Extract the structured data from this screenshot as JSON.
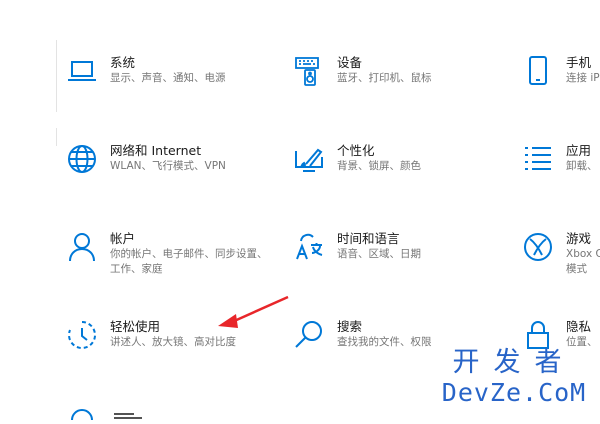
{
  "tiles": [
    {
      "title": "系统",
      "desc": [
        "显示、声音、通知、电源"
      ]
    },
    {
      "title": "设备",
      "desc": [
        "蓝牙、打印机、鼠标"
      ]
    },
    {
      "title": "手机",
      "desc": [
        "连接 iP"
      ]
    },
    {
      "title": "网络和 Internet",
      "desc": [
        "WLAN、飞行模式、VPN"
      ]
    },
    {
      "title": "个性化",
      "desc": [
        "背景、锁屏、颜色"
      ]
    },
    {
      "title": "应用",
      "desc": [
        "卸载、"
      ]
    },
    {
      "title": "帐户",
      "desc": [
        "你的帐户、电子邮件、同步设置、",
        "工作、家庭"
      ]
    },
    {
      "title": "时间和语言",
      "desc": [
        "语音、区域、日期"
      ]
    },
    {
      "title": "游戏",
      "desc": [
        "Xbox G",
        "模式"
      ]
    },
    {
      "title": "轻松使用",
      "desc": [
        "讲述人、放大镜、高对比度"
      ]
    },
    {
      "title": "搜索",
      "desc": [
        "查找我的文件、权限"
      ]
    },
    {
      "title": "隐私",
      "desc": [
        "位置、"
      ]
    }
  ],
  "watermark": {
    "line1": "开发者",
    "line2": "DevZe.CoM"
  },
  "colors": {
    "accent": "#0078d7",
    "arrow": "#e8262a",
    "watermark": "#2864c8"
  },
  "icons": [
    "laptop-icon",
    "keyboard-speaker-icon",
    "phone-icon",
    "globe-icon",
    "paint-monitor-icon",
    "apps-list-icon",
    "person-icon",
    "time-language-icon",
    "xbox-icon",
    "ease-of-access-icon",
    "search-icon",
    "lock-icon"
  ]
}
